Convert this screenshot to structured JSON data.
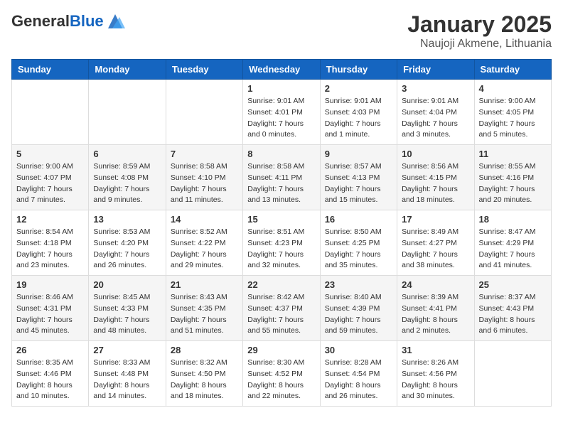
{
  "header": {
    "logo_general": "General",
    "logo_blue": "Blue",
    "month_title": "January 2025",
    "subtitle": "Naujoji Akmene, Lithuania"
  },
  "weekdays": [
    "Sunday",
    "Monday",
    "Tuesday",
    "Wednesday",
    "Thursday",
    "Friday",
    "Saturday"
  ],
  "weeks": [
    [
      {
        "day": "",
        "info": ""
      },
      {
        "day": "",
        "info": ""
      },
      {
        "day": "",
        "info": ""
      },
      {
        "day": "1",
        "info": "Sunrise: 9:01 AM\nSunset: 4:01 PM\nDaylight: 7 hours\nand 0 minutes."
      },
      {
        "day": "2",
        "info": "Sunrise: 9:01 AM\nSunset: 4:03 PM\nDaylight: 7 hours\nand 1 minute."
      },
      {
        "day": "3",
        "info": "Sunrise: 9:01 AM\nSunset: 4:04 PM\nDaylight: 7 hours\nand 3 minutes."
      },
      {
        "day": "4",
        "info": "Sunrise: 9:00 AM\nSunset: 4:05 PM\nDaylight: 7 hours\nand 5 minutes."
      }
    ],
    [
      {
        "day": "5",
        "info": "Sunrise: 9:00 AM\nSunset: 4:07 PM\nDaylight: 7 hours\nand 7 minutes."
      },
      {
        "day": "6",
        "info": "Sunrise: 8:59 AM\nSunset: 4:08 PM\nDaylight: 7 hours\nand 9 minutes."
      },
      {
        "day": "7",
        "info": "Sunrise: 8:58 AM\nSunset: 4:10 PM\nDaylight: 7 hours\nand 11 minutes."
      },
      {
        "day": "8",
        "info": "Sunrise: 8:58 AM\nSunset: 4:11 PM\nDaylight: 7 hours\nand 13 minutes."
      },
      {
        "day": "9",
        "info": "Sunrise: 8:57 AM\nSunset: 4:13 PM\nDaylight: 7 hours\nand 15 minutes."
      },
      {
        "day": "10",
        "info": "Sunrise: 8:56 AM\nSunset: 4:15 PM\nDaylight: 7 hours\nand 18 minutes."
      },
      {
        "day": "11",
        "info": "Sunrise: 8:55 AM\nSunset: 4:16 PM\nDaylight: 7 hours\nand 20 minutes."
      }
    ],
    [
      {
        "day": "12",
        "info": "Sunrise: 8:54 AM\nSunset: 4:18 PM\nDaylight: 7 hours\nand 23 minutes."
      },
      {
        "day": "13",
        "info": "Sunrise: 8:53 AM\nSunset: 4:20 PM\nDaylight: 7 hours\nand 26 minutes."
      },
      {
        "day": "14",
        "info": "Sunrise: 8:52 AM\nSunset: 4:22 PM\nDaylight: 7 hours\nand 29 minutes."
      },
      {
        "day": "15",
        "info": "Sunrise: 8:51 AM\nSunset: 4:23 PM\nDaylight: 7 hours\nand 32 minutes."
      },
      {
        "day": "16",
        "info": "Sunrise: 8:50 AM\nSunset: 4:25 PM\nDaylight: 7 hours\nand 35 minutes."
      },
      {
        "day": "17",
        "info": "Sunrise: 8:49 AM\nSunset: 4:27 PM\nDaylight: 7 hours\nand 38 minutes."
      },
      {
        "day": "18",
        "info": "Sunrise: 8:47 AM\nSunset: 4:29 PM\nDaylight: 7 hours\nand 41 minutes."
      }
    ],
    [
      {
        "day": "19",
        "info": "Sunrise: 8:46 AM\nSunset: 4:31 PM\nDaylight: 7 hours\nand 45 minutes."
      },
      {
        "day": "20",
        "info": "Sunrise: 8:45 AM\nSunset: 4:33 PM\nDaylight: 7 hours\nand 48 minutes."
      },
      {
        "day": "21",
        "info": "Sunrise: 8:43 AM\nSunset: 4:35 PM\nDaylight: 7 hours\nand 51 minutes."
      },
      {
        "day": "22",
        "info": "Sunrise: 8:42 AM\nSunset: 4:37 PM\nDaylight: 7 hours\nand 55 minutes."
      },
      {
        "day": "23",
        "info": "Sunrise: 8:40 AM\nSunset: 4:39 PM\nDaylight: 7 hours\nand 59 minutes."
      },
      {
        "day": "24",
        "info": "Sunrise: 8:39 AM\nSunset: 4:41 PM\nDaylight: 8 hours\nand 2 minutes."
      },
      {
        "day": "25",
        "info": "Sunrise: 8:37 AM\nSunset: 4:43 PM\nDaylight: 8 hours\nand 6 minutes."
      }
    ],
    [
      {
        "day": "26",
        "info": "Sunrise: 8:35 AM\nSunset: 4:46 PM\nDaylight: 8 hours\nand 10 minutes."
      },
      {
        "day": "27",
        "info": "Sunrise: 8:33 AM\nSunset: 4:48 PM\nDaylight: 8 hours\nand 14 minutes."
      },
      {
        "day": "28",
        "info": "Sunrise: 8:32 AM\nSunset: 4:50 PM\nDaylight: 8 hours\nand 18 minutes."
      },
      {
        "day": "29",
        "info": "Sunrise: 8:30 AM\nSunset: 4:52 PM\nDaylight: 8 hours\nand 22 minutes."
      },
      {
        "day": "30",
        "info": "Sunrise: 8:28 AM\nSunset: 4:54 PM\nDaylight: 8 hours\nand 26 minutes."
      },
      {
        "day": "31",
        "info": "Sunrise: 8:26 AM\nSunset: 4:56 PM\nDaylight: 8 hours\nand 30 minutes."
      },
      {
        "day": "",
        "info": ""
      }
    ]
  ]
}
